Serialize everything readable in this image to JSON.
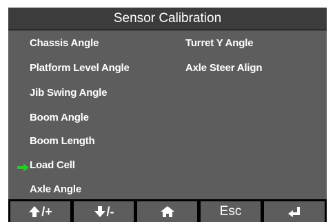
{
  "header": {
    "title": "Sensor Calibration"
  },
  "menu": {
    "left_items": [
      {
        "label": "Chassis Angle"
      },
      {
        "label": "Platform Level Angle"
      },
      {
        "label": "Jib Swing Angle"
      },
      {
        "label": "Boom Angle"
      },
      {
        "label": "Boom Length"
      },
      {
        "label": "Load Cell"
      },
      {
        "label": "Axle Angle"
      }
    ],
    "right_items": [
      {
        "label": "Turret Y Angle"
      },
      {
        "label": "Axle Steer Align"
      }
    ],
    "selected_item": "Boom Length",
    "selection_icon": "right-arrow-icon"
  },
  "footer": {
    "buttons": [
      {
        "name": "up-plus",
        "label": "/+",
        "icon": "up-arrow-icon"
      },
      {
        "name": "down-minus",
        "label": "/-",
        "icon": "down-arrow-icon"
      },
      {
        "name": "home",
        "label": "",
        "icon": "home-icon"
      },
      {
        "name": "esc",
        "label": "Esc",
        "icon": ""
      },
      {
        "name": "enter",
        "label": "",
        "icon": "enter-icon"
      }
    ]
  },
  "colors": {
    "screen_bg": "#5d5d5d",
    "title_bg": "#3c3c3c",
    "frame": "#000000",
    "text": "#ffffff",
    "selection_arrow": "#22cc22"
  }
}
